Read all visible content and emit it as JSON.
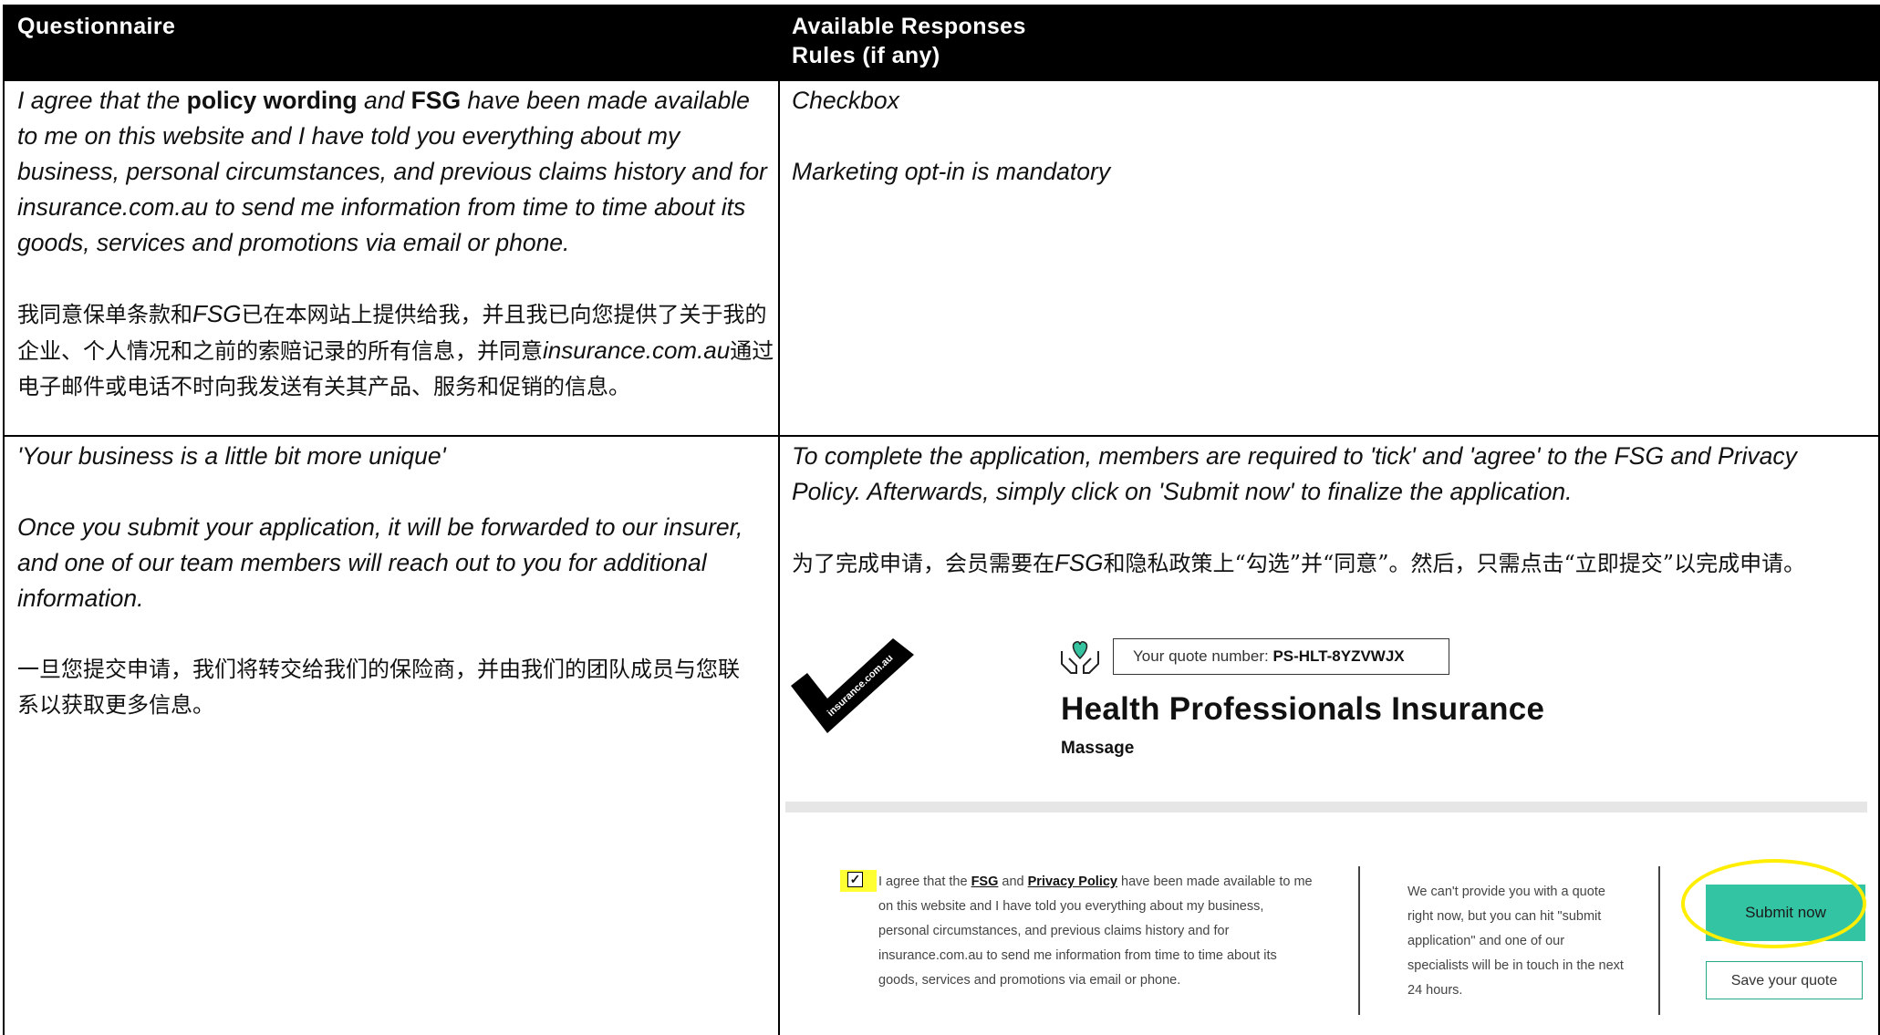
{
  "header": {
    "col1": "Questionnaire",
    "col2": "Available Responses\nRules (if any)"
  },
  "row1": {
    "left_en_pre": "I agree that the ",
    "left_en_b1": "policy wording",
    "left_en_mid": " and ",
    "left_en_b2": "FSG",
    "left_en_post": " have been made available to me on this website and I have told you everything about my business, personal circumstances, and previous claims history and for insurance.com.au to send me information from time to time about its goods, services and promotions via email or phone.",
    "left_zh_1": "我同意保单条款和",
    "left_zh_fsg": "FSG",
    "left_zh_2": "已在本网站上提供给我，并且我已向您提供了关于我的企业、个人情况和之前的索赔记录的所有信息，并同意",
    "left_zh_site": "insurance.com.au",
    "left_zh_3": "通过电子邮件或电话不时向我发送有关其产品、服务和促销的信息。",
    "right_1": "Checkbox",
    "right_2": "Marketing opt-in is mandatory"
  },
  "row2": {
    "left_1": "'Your business is a little bit more unique'",
    "left_2": "Once you submit your application, it will be forwarded to our insurer, and one of our team members will reach out to you for additional information.",
    "left_zh": "一旦您提交申请，我们将转交给我们的保险商，并由我们的团队成员与您联系以获取更多信息。",
    "right_en": "To complete the application, members are required to 'tick' and 'agree' to the FSG and Privacy Policy. Afterwards, simply click on 'Submit now' to finalize the application.",
    "right_zh_1": "为了完成申请，会员需要在",
    "right_zh_fsg": "FSG",
    "right_zh_2": "和隐私政策上“勾选”并“同意”。然后，只需点击“立即提交”以完成申请。"
  },
  "screenshot": {
    "logo_text": "insurance.com.au",
    "quote_label": "Your quote number: ",
    "quote_number": "PS-HLT-8YZVWJX",
    "product_title": "Health Professionals Insurance",
    "product_sub": "Massage",
    "agree_pre": "I agree that the ",
    "agree_fsg": "FSG",
    "agree_and": " and ",
    "agree_privacy": "Privacy Policy",
    "agree_post": " have been made available to me on this website and I have told you everything about my business, personal circumstances, and previous claims history and for insurance.com.au to send me information from time to time about its goods, services and promotions via email or phone.",
    "note": "We can't provide you with a quote right now, but you can hit \"submit application\" and one of our specialists will be in touch in the next 24 hours.",
    "submit_label": "Submit now",
    "save_label": "Save your quote",
    "checkbox_mark": "✓"
  },
  "colors": {
    "header_bg": "#000000",
    "highlight": "#ffee00",
    "submit_bg": "#33c4a3",
    "save_border": "#22a88a"
  }
}
